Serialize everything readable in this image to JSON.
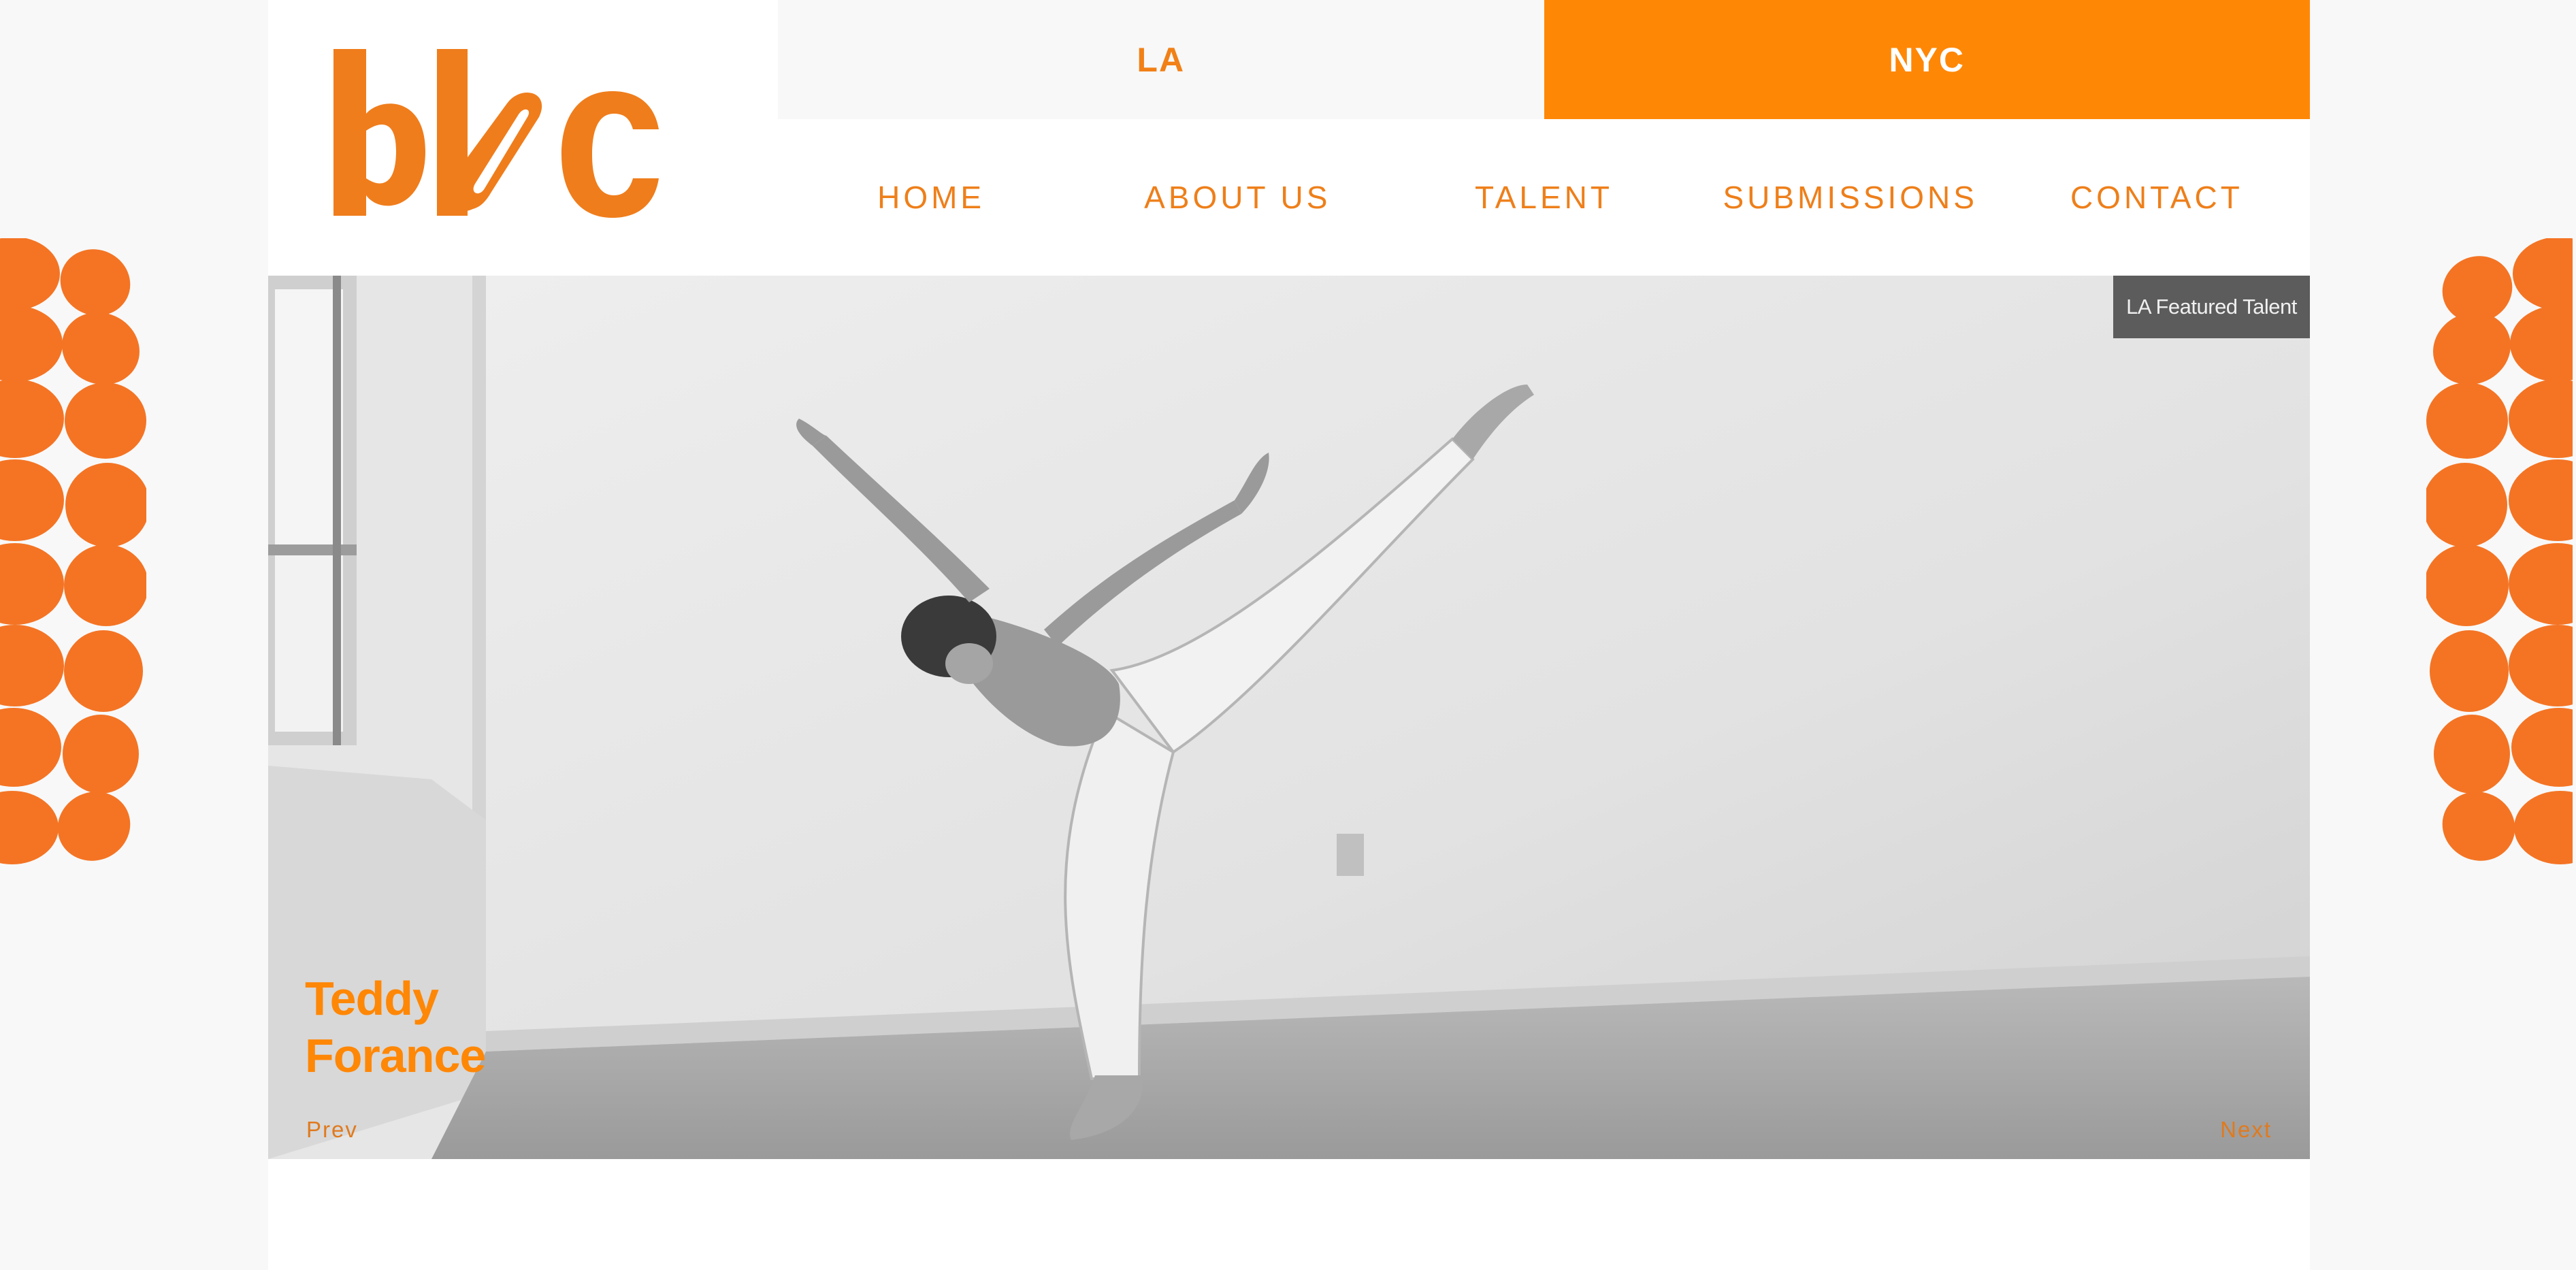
{
  "brand": {
    "logo_text": "bloc",
    "accent": "#f18016",
    "accent_bright": "#ff8706"
  },
  "city_tabs": [
    {
      "label": "LA",
      "active": false
    },
    {
      "label": "NYC",
      "active": true
    }
  ],
  "nav": {
    "items": [
      {
        "label": "HOME"
      },
      {
        "label": "ABOUT US"
      },
      {
        "label": "TALENT"
      },
      {
        "label": "SUBMISSIONS"
      },
      {
        "label": "CONTACT"
      }
    ]
  },
  "hero": {
    "badge": "LA Featured Talent",
    "talent_first_name": "Teddy",
    "talent_last_name": "Forance",
    "prev_label": "Prev",
    "next_label": "Next"
  }
}
